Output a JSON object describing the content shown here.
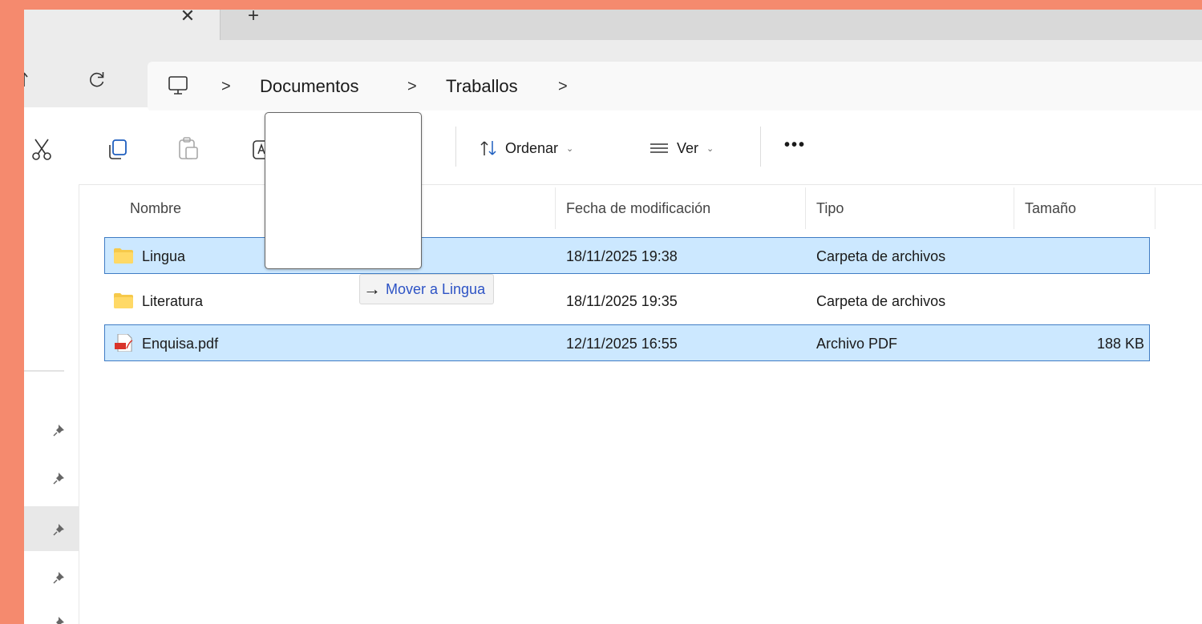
{
  "tabbar": {
    "close_glyph": "✕",
    "new_tab_glyph": "+"
  },
  "address": {
    "breadcrumb": [
      "Documentos",
      "Traballos"
    ],
    "separator": ">"
  },
  "toolbar": {
    "sort_label": "Ordenar",
    "view_label": "Ver",
    "more_label": "•••"
  },
  "columns": {
    "name": "Nombre",
    "date": "Fecha de modificación",
    "type": "Tipo",
    "size": "Tamaño"
  },
  "files": [
    {
      "name": "Lingua",
      "date": "18/11/2025 19:38",
      "type": "Carpeta de archivos",
      "size": "",
      "icon": "folder-icon",
      "selected": true
    },
    {
      "name": "Literatura",
      "date": "18/11/2025 19:35",
      "type": "Carpeta de archivos",
      "size": "",
      "icon": "folder-icon",
      "selected": false
    },
    {
      "name": "Enquisa.pdf",
      "date": "12/11/2025 16:55",
      "type": "Archivo PDF",
      "size": "188 KB",
      "icon": "pdf-file-icon",
      "selected": true
    }
  ],
  "drag": {
    "tooltip_arrow": "→",
    "tooltip_text": "Mover a Lingua"
  },
  "colors": {
    "background": "#f58a6e",
    "selection": "#cce8ff",
    "selection_border": "#3f7cc4",
    "folder": "#f6c94a",
    "link_blue": "#2d53c5"
  }
}
